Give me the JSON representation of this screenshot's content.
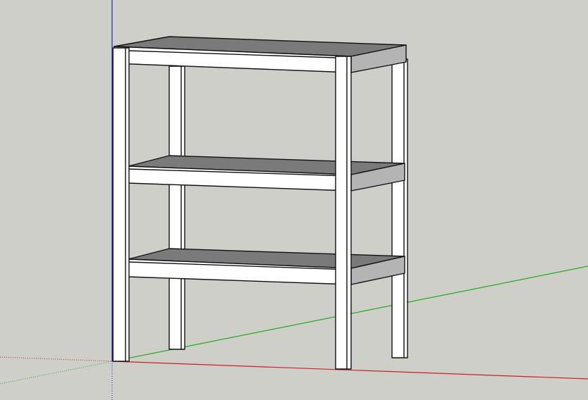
{
  "viewport": {
    "background_color": "#cfcfca",
    "axis_colors": {
      "x_axis": "#cc2222",
      "y_axis": "#22aa22",
      "z_axis": "#2222cc"
    }
  },
  "model": {
    "object": "three-tier-shelf",
    "shelf_count": 3,
    "colors": {
      "frame_face": "#ffffff",
      "shelf_top": "#7a7a7a",
      "shelf_edge": "#b4b4b4",
      "edge_line": "#111111"
    }
  }
}
